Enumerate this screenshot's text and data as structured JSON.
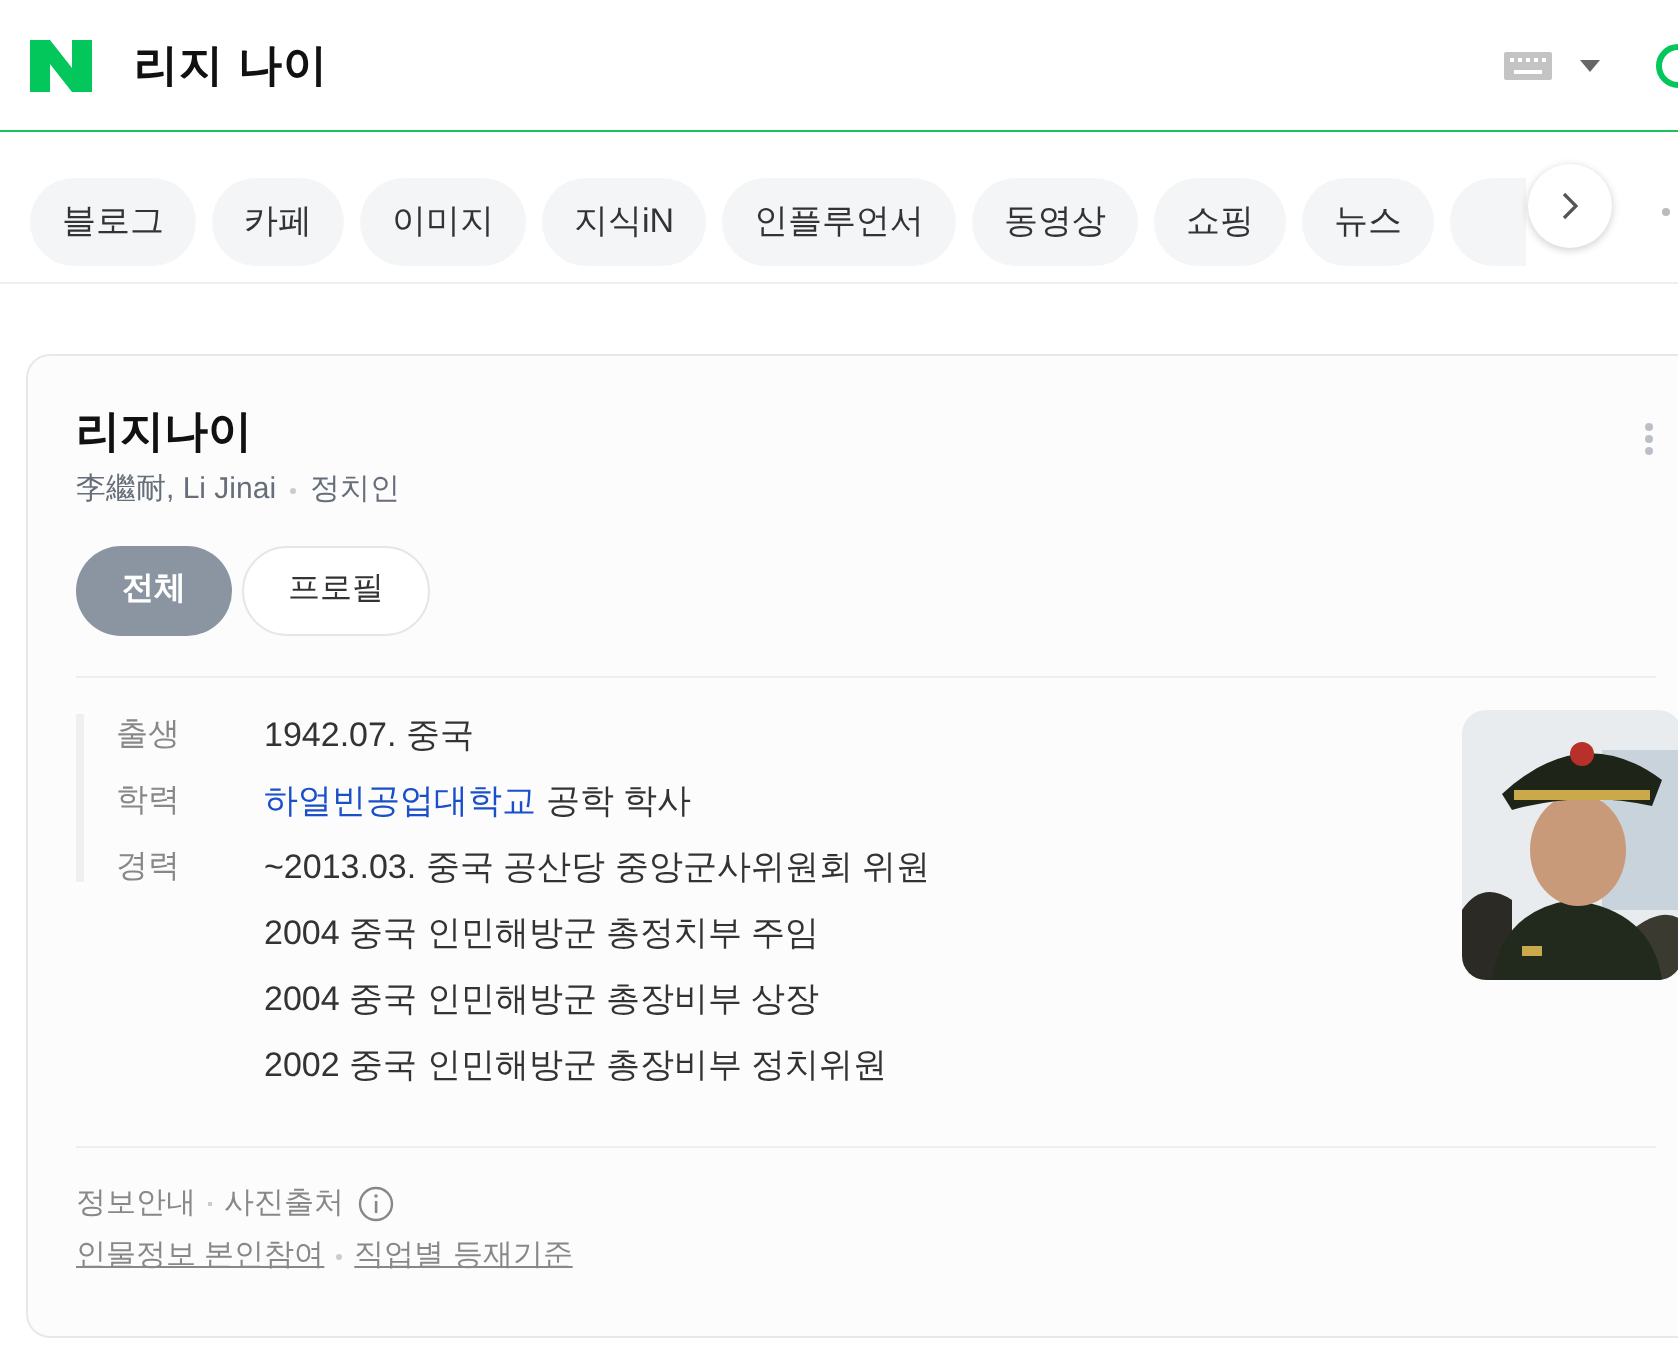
{
  "search": {
    "query": "리지 나이"
  },
  "tabs": [
    {
      "label": "블로그"
    },
    {
      "label": "카페"
    },
    {
      "label": "이미지"
    },
    {
      "label": "지식iN"
    },
    {
      "label": "인플루언서"
    },
    {
      "label": "동영상"
    },
    {
      "label": "쇼핑"
    },
    {
      "label": "뉴스"
    }
  ],
  "profile": {
    "name": "리지나이",
    "aliases": "李繼耐, Li Jinai",
    "occupation": "정치인",
    "tabs": [
      {
        "label": "전체",
        "selected": true
      },
      {
        "label": "프로필",
        "selected": false
      }
    ],
    "info": [
      {
        "label": "출생",
        "lines": [
          [
            {
              "kind": "text",
              "text": "1942.07. 중국"
            }
          ]
        ]
      },
      {
        "label": "학력",
        "lines": [
          [
            {
              "kind": "link",
              "text": "하얼빈공업대학교"
            },
            {
              "kind": "text",
              "text": "공학 학사"
            }
          ]
        ]
      },
      {
        "label": "경력",
        "lines": [
          [
            {
              "kind": "text",
              "text": "~2013.03. 중국 공산당 중앙군사위원회 위원"
            }
          ],
          [
            {
              "kind": "text",
              "text": "2004 중국 인민해방군 총정치부 주임"
            }
          ],
          [
            {
              "kind": "text",
              "text": "2004 중국 인민해방군 총장비부 상장"
            }
          ],
          [
            {
              "kind": "text",
              "text": "2002 중국 인민해방군 총장비부 정치위원"
            }
          ]
        ]
      }
    ],
    "footer": {
      "notes": [
        "정보안내",
        "사진출처"
      ],
      "links": [
        "인물정보 본인참여",
        "직업별 등재기준"
      ]
    }
  }
}
